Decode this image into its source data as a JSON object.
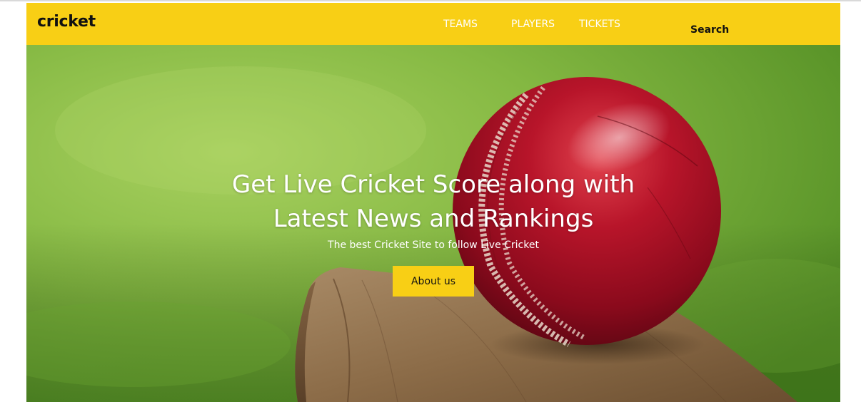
{
  "brand": {
    "name": "cricket"
  },
  "nav": {
    "items": [
      {
        "label": "TEAMS"
      },
      {
        "label": "PLAYERS"
      },
      {
        "label": "TICKETS"
      }
    ],
    "search_label": "Search"
  },
  "hero": {
    "title_line1": "Get Live Cricket Score along with",
    "title_line2": "Latest News and Rankings",
    "subtitle": "The best Cricket Site to follow Live Cricket",
    "button_label": "About us",
    "image": "cricket-ball-on-bat"
  },
  "colors": {
    "accent": "#f8cf15",
    "nav_text": "#ffffff",
    "brand_text": "#111111"
  }
}
